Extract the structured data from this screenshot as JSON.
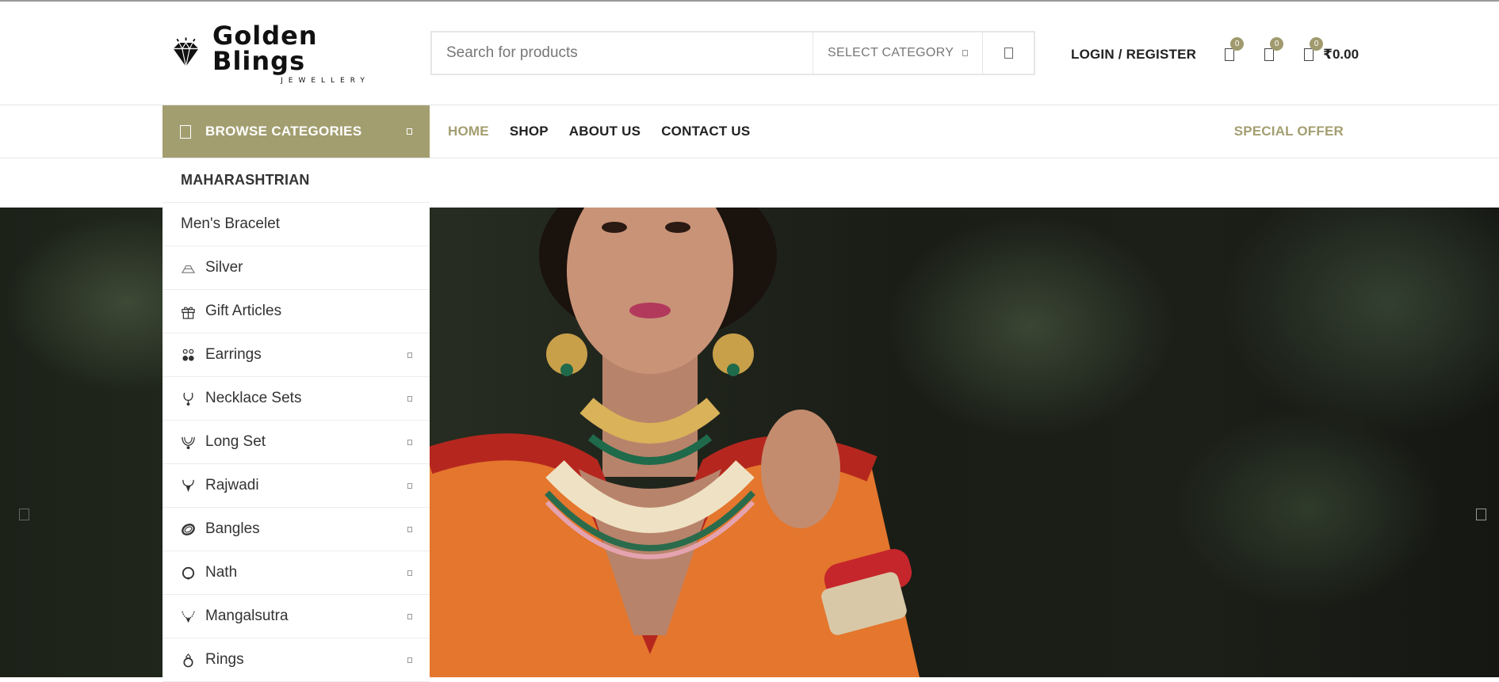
{
  "brand": {
    "name": "Golden Blings",
    "tagline": "JEWELLERY"
  },
  "search": {
    "placeholder": "Search for products",
    "category_label": "SELECT CATEGORY"
  },
  "header": {
    "login_label": "LOGIN / REGISTER",
    "wishlist_count": "0",
    "compare_count": "0",
    "cart_count": "0",
    "cart_total": "₹0.00"
  },
  "nav": {
    "browse_label": "BROWSE CATEGORIES",
    "items": [
      {
        "label": "HOME"
      },
      {
        "label": "SHOP"
      },
      {
        "label": "ABOUT US"
      },
      {
        "label": "CONTACT US"
      }
    ],
    "special_label": "SPECIAL OFFER"
  },
  "categories": [
    {
      "label": "MAHARASHTRIAN",
      "icon": "none",
      "has_children": false
    },
    {
      "label": "Men's Bracelet",
      "icon": "none",
      "has_children": false
    },
    {
      "label": "Silver",
      "icon": "silver-bars-icon",
      "has_children": false
    },
    {
      "label": "Gift Articles",
      "icon": "gift-icon",
      "has_children": false
    },
    {
      "label": "Earrings",
      "icon": "earrings-icon",
      "has_children": true
    },
    {
      "label": "Necklace Sets",
      "icon": "necklace-icon",
      "has_children": true
    },
    {
      "label": "Long Set",
      "icon": "long-necklace-icon",
      "has_children": true
    },
    {
      "label": "Rajwadi",
      "icon": "pendant-icon",
      "has_children": true
    },
    {
      "label": "Bangles",
      "icon": "bangle-icon",
      "has_children": true
    },
    {
      "label": "Nath",
      "icon": "nose-ring-icon",
      "has_children": true
    },
    {
      "label": "Mangalsutra",
      "icon": "mangalsutra-icon",
      "has_children": true
    },
    {
      "label": "Rings",
      "icon": "ring-icon",
      "has_children": true
    }
  ],
  "colors": {
    "accent": "#a39e70",
    "text": "#222222",
    "border": "#e6e6e6"
  }
}
